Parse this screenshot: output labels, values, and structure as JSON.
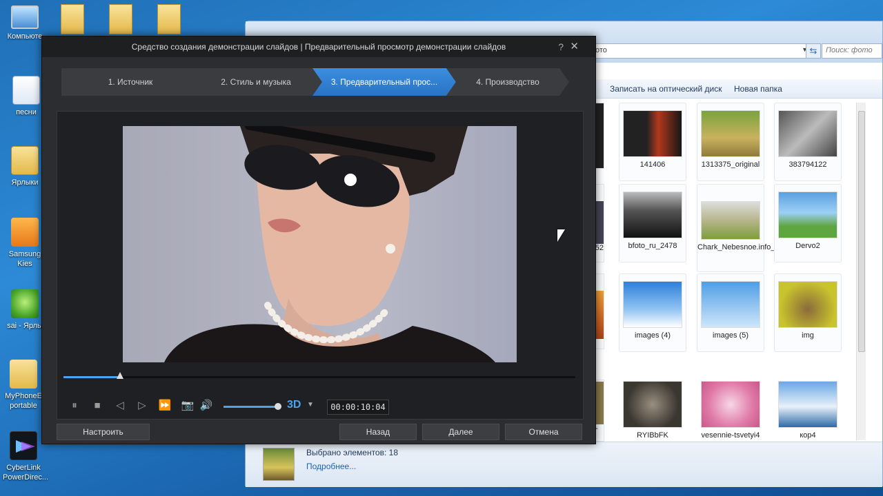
{
  "desktop": {
    "icons": [
      {
        "label": "Компьюте",
        "icon": "computer-icon"
      },
      {
        "label": "песни",
        "icon": "word-document-icon"
      },
      {
        "label": "Ярлыки",
        "icon": "folder-icon"
      },
      {
        "label": "Samsung Kies",
        "icon": "samsung-kies-icon"
      },
      {
        "label": "sai - Ярлы",
        "icon": "sai-icon"
      },
      {
        "label": "MyPhoneE portable",
        "icon": "myphone-explorer-icon"
      },
      {
        "label": "CyberLink PowerDirec...",
        "icon": "cyberlink-powerdirector-icon"
      }
    ]
  },
  "explorer": {
    "address_text": "ото",
    "search_placeholder": "Поиск: фото",
    "toolbar": {
      "burn": "Записать на оптический диск",
      "new_folder": "Новая папка"
    },
    "tiles": [
      {
        "label": "141406"
      },
      {
        "label": "1313375_original"
      },
      {
        "label": "383794122"
      },
      {
        "label": "bfoto_ru_2478"
      },
      {
        "label": "Chark_Nebesnoe.info_32"
      },
      {
        "label": "Dervo2"
      },
      {
        "label": "images (4)"
      },
      {
        "label": "images (5)"
      },
      {
        "label": "img"
      },
      {
        "label": "RYIBbFK"
      },
      {
        "label": "vesennie-tsvetyi4"
      },
      {
        "label": "кор4"
      }
    ],
    "partial_labels": [
      "52",
      "e-"
    ],
    "details": {
      "selected": "Выбрано элементов: 18",
      "more": "Подробнее..."
    }
  },
  "dialog": {
    "title": "Средство создания демонстрации слайдов | Предварительный просмотр демонстрации слайдов",
    "help": "?",
    "close": "✕",
    "steps": [
      {
        "label": "1. Источник"
      },
      {
        "label": "2. Стиль и музыка"
      },
      {
        "label": "3. Предварительный прос..."
      },
      {
        "label": "4. Производство"
      }
    ],
    "active_step": 3,
    "playback": {
      "progress": 0.11,
      "volume": 0.98,
      "three_d": "3D",
      "time": "00:00:10:04"
    },
    "buttons": {
      "customize": "Настроить",
      "back": "Назад",
      "next": "Далее",
      "cancel": "Отмена"
    }
  }
}
